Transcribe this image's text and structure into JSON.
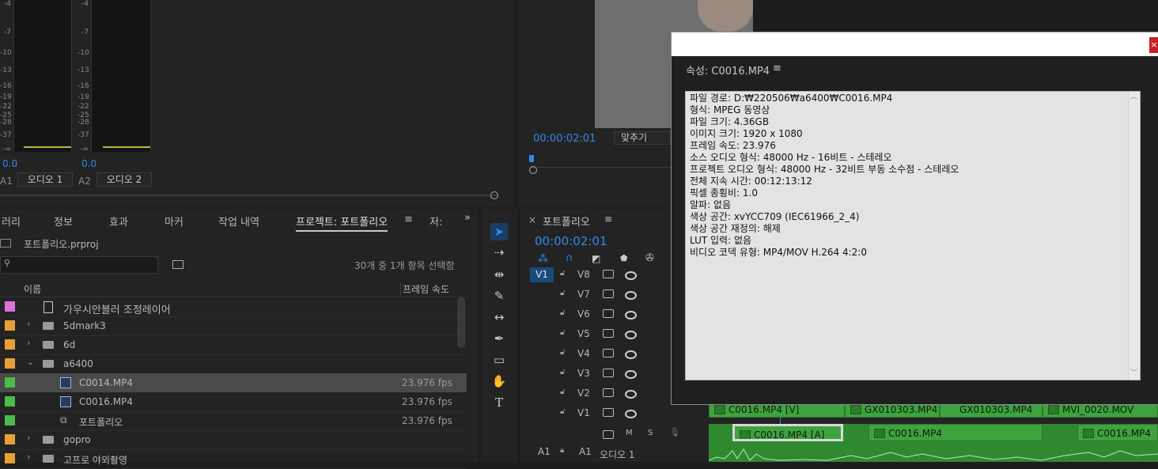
{
  "audio_meters": {
    "scale": [
      "-4",
      "-7",
      "-10",
      "-13",
      "-16",
      "-19",
      "-22",
      "-25",
      "-28",
      "-37",
      "-∞"
    ],
    "channels": [
      {
        "level": "0.0",
        "id": "A1",
        "name": "오디오 1"
      },
      {
        "level": "0.0",
        "id": "A2",
        "name": "오디오 2"
      }
    ]
  },
  "program_monitor": {
    "timecode": "00:00:02:01",
    "zoom": "맞추기"
  },
  "project_panel": {
    "tabs": [
      "러리",
      "정보",
      "효과",
      "마커",
      "작업 내역",
      "프로젝트: 포트폴리오",
      "저:"
    ],
    "active_tab_index": 5,
    "project_file": "포트폴리오.prproj",
    "selection_status": "30개 중 1개 항목 선택함",
    "columns": {
      "name": "이름",
      "frame_rate": "프레임 속도"
    },
    "items": [
      {
        "name": "가우시안블러 조정레이어",
        "fps": "",
        "color": "#d875d8",
        "kind": "adjust",
        "indent": 1
      },
      {
        "name": "5dmark3",
        "fps": "",
        "color": "#e8a03a",
        "kind": "folder",
        "indent": 0
      },
      {
        "name": "6d",
        "fps": "",
        "color": "#e8a03a",
        "kind": "folder",
        "indent": 0
      },
      {
        "name": "a6400",
        "fps": "",
        "color": "#e8a03a",
        "kind": "folder-open",
        "indent": 0
      },
      {
        "name": "C0014.MP4",
        "fps": "23.976 fps",
        "color": "#4cba4c",
        "kind": "clip",
        "indent": 2,
        "selected": true
      },
      {
        "name": "C0016.MP4",
        "fps": "23.976 fps",
        "color": "#4cba4c",
        "kind": "clip",
        "indent": 2
      },
      {
        "name": "포트폴리오",
        "fps": "23.976 fps",
        "color": "#4cba4c",
        "kind": "sequence",
        "indent": 2
      },
      {
        "name": "gopro",
        "fps": "",
        "color": "#e8a03a",
        "kind": "folder",
        "indent": 0
      },
      {
        "name": "고프로 야외촬영",
        "fps": "",
        "color": "#e8a03a",
        "kind": "folder",
        "indent": 0
      }
    ]
  },
  "timeline": {
    "sequence_name": "포트폴리오",
    "timecode": "00:00:02:01",
    "video_tracks": [
      "V8",
      "V7",
      "V6",
      "V5",
      "V4",
      "V3",
      "V2",
      "V1"
    ],
    "audio_track": {
      "source": "A1",
      "id": "A1",
      "name": "오디오 1",
      "mute": "M",
      "solo": "S"
    },
    "active_source": "V1",
    "video_clips": [
      "C0016.MP4 [V]",
      "GX010303.MP4",
      "GX010303.MP4",
      "MVI_0020.MOV"
    ],
    "audio_clips": [
      "C0016.MP4 [A]",
      "C0016.MP4",
      "C0016.MP4"
    ]
  },
  "properties_dialog": {
    "close_label": "×",
    "heading": "속성: C0016.MP4",
    "lines": [
      "파일 경로: D:₩220506₩a6400₩C0016.MP4",
      "형식: MPEG 동영상",
      "파일 크기: 4.36GB",
      "이미지 크기: 1920 x 1080",
      "프레임 속도: 23.976",
      "소스 오디오 형식: 48000 Hz - 16비트 - 스테레오",
      "프로젝트 오디오 형식: 48000 Hz - 32비트 부동 소수점 - 스테레오",
      "전체 지속 시간: 00:12:13:12",
      "픽셀 종횡비: 1.0",
      "알파: 없음",
      "색상 공간: xvYCC709 (IEC61966_2_4)",
      "색상 공간 재정의: 해제",
      "LUT 입력: 없음",
      "비디오 코덱 유형: MP4/MOV H.264 4:2:0"
    ]
  }
}
